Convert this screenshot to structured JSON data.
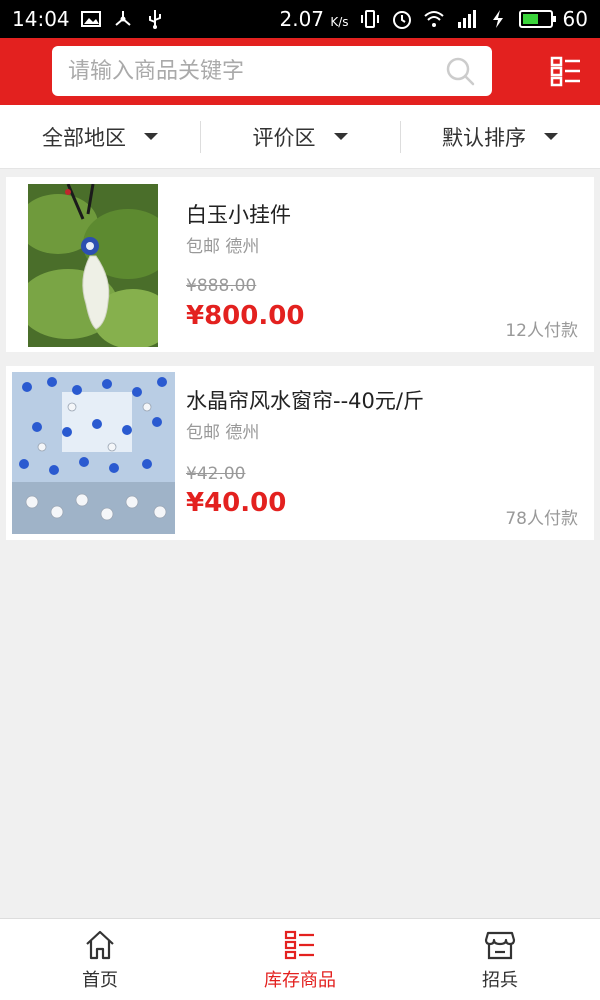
{
  "status_bar": {
    "time": "14:04",
    "network_speed": "2.07",
    "speed_unit": "K/s",
    "battery_level": "60"
  },
  "header": {
    "search_placeholder": "请输入商品关键字"
  },
  "filters": [
    {
      "label": "全部地区"
    },
    {
      "label": "评价区"
    },
    {
      "label": "默认排序"
    }
  ],
  "products": [
    {
      "name": "白玉小挂件",
      "meta": "包邮 德州",
      "original_price": "¥888.00",
      "price": "¥800.00",
      "buyers": "12人付款"
    },
    {
      "name": "水晶帘风水窗帘--40元/斤",
      "meta": "包邮 德州",
      "original_price": "¥42.00",
      "price": "¥40.00",
      "buyers": "78人付款"
    }
  ],
  "bottom_nav": [
    {
      "label": "首页",
      "active": false
    },
    {
      "label": "库存商品",
      "active": true
    },
    {
      "label": "招兵",
      "active": false
    }
  ],
  "colors": {
    "brand_red": "#e3211f",
    "background": "#f0f0f0"
  }
}
